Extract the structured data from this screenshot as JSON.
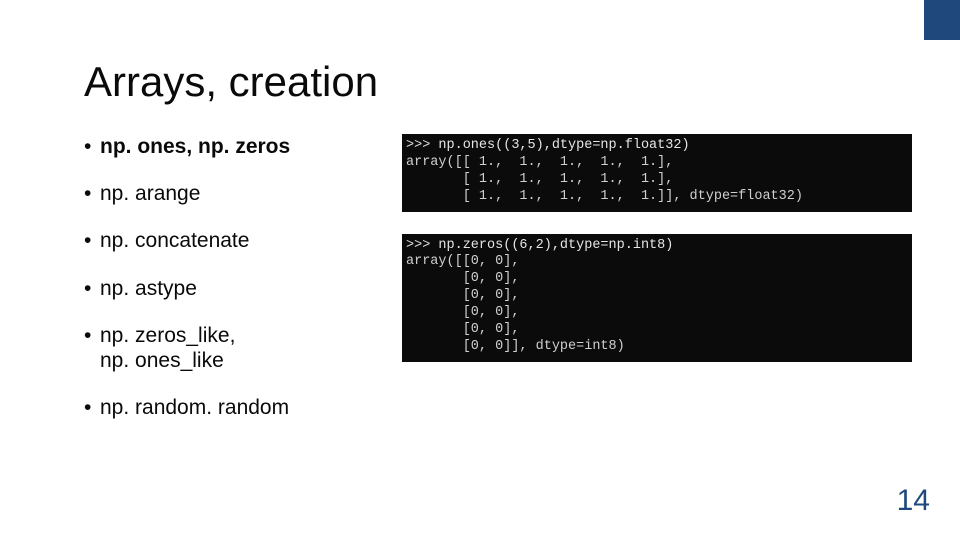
{
  "accent_color": "#1f497d",
  "title": "Arrays, creation",
  "bullets": [
    {
      "text": "np. ones, np. zeros",
      "bold": true
    },
    {
      "text": "np. arange"
    },
    {
      "text": "np. concatenate"
    },
    {
      "text": "np. astype"
    },
    {
      "text": "np. zeros_like,",
      "sub": "np. ones_like"
    },
    {
      "text": "np. random. random"
    }
  ],
  "console1": {
    "prompt": ">>> ",
    "cmd": "np.ones((3,5),dtype=np.float32)",
    "out": "array([[ 1.,  1.,  1.,  1.,  1.],\n       [ 1.,  1.,  1.,  1.,  1.],\n       [ 1.,  1.,  1.,  1.,  1.]], dtype=float32)"
  },
  "console2": {
    "prompt": ">>> ",
    "cmd": "np.zeros((6,2),dtype=np.int8)",
    "out": "array([[0, 0],\n       [0, 0],\n       [0, 0],\n       [0, 0],\n       [0, 0],\n       [0, 0]], dtype=int8)"
  },
  "page_number": "14"
}
